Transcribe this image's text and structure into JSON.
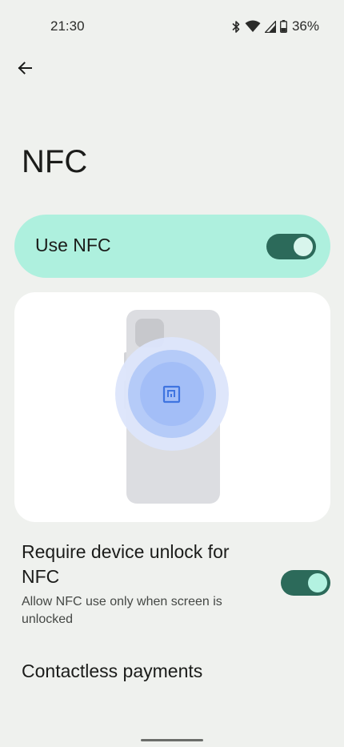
{
  "status_bar": {
    "time": "21:30",
    "battery_percent": "36%",
    "icons": [
      "bluetooth-icon",
      "wifi-icon",
      "cell-signal-icon",
      "battery-icon"
    ]
  },
  "header": {
    "back_icon": "arrow-back-icon",
    "title": "NFC"
  },
  "use_nfc": {
    "label": "Use NFC",
    "enabled": true
  },
  "illustration": {
    "icon": "nfc-icon",
    "colors": {
      "accent": "#3f74e0",
      "phone": "#dcdde1"
    }
  },
  "require_unlock": {
    "title": "Require device unlock for NFC",
    "summary": "Allow NFC use only when screen is unlocked",
    "enabled": true
  },
  "contactless": {
    "label": "Contactless payments"
  },
  "colors": {
    "background": "#eff1ee",
    "primary_container": "#aef0de",
    "toggle_track": "#2c6a5a"
  }
}
